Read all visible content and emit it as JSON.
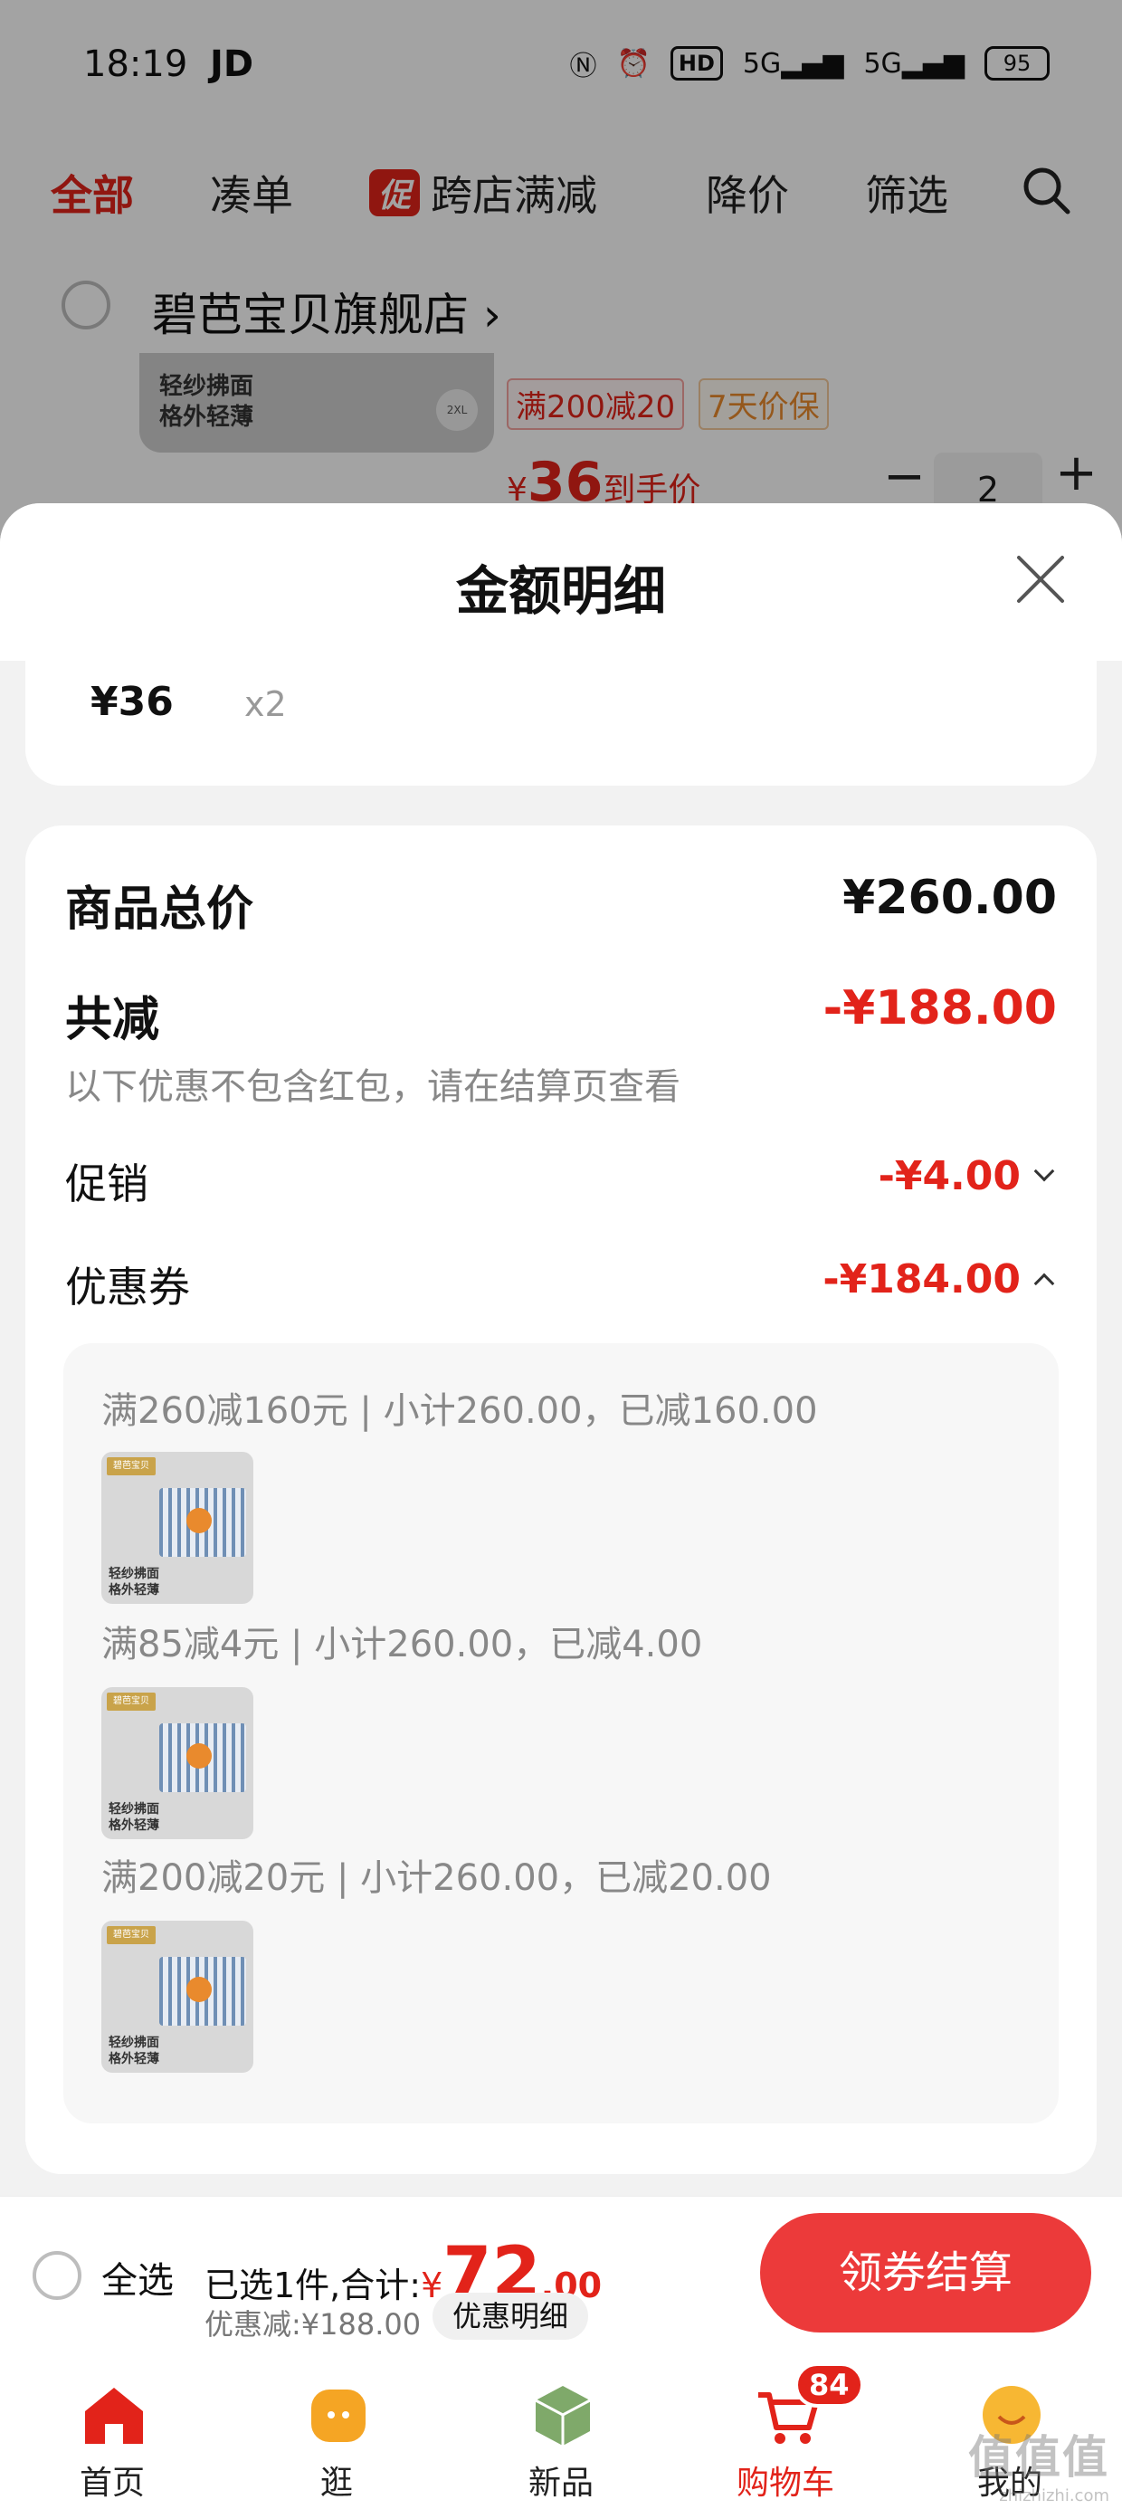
{
  "status_bar": {
    "time": "18:19",
    "carrier": "JD",
    "net_badge": "HD",
    "signal1": "5G",
    "signal2": "5G",
    "battery": "95"
  },
  "tabs": {
    "all": "全部",
    "combine": "凑单",
    "promo_chip": "促",
    "cross_store": "跨店满减",
    "price_drop": "降价",
    "filter": "筛选"
  },
  "shop": {
    "name": "碧芭宝贝旗舰店",
    "thumb_line1": "轻纱拂面",
    "thumb_line2": "格外轻薄",
    "thumb_size": "2XL",
    "tag1": "满200减20",
    "tag2": "7天价保",
    "price_symbol": "¥",
    "price": "36",
    "price_note": "到手价",
    "quantity": "2",
    "minus": "−",
    "plus": "+"
  },
  "sheet": {
    "title": "金额明细",
    "item_price": "¥36",
    "item_qty": "x2",
    "total_label": "商品总价",
    "total_value": "¥260.00",
    "reduce_label": "共减",
    "reduce_value": "-¥188.00",
    "reduce_hint": "以下优惠不包含红包，请在结算页查看",
    "promo_label": "促销",
    "promo_value": "-¥4.00",
    "coupon_label": "优惠券",
    "coupon_value": "-¥184.00",
    "coupons": [
      {
        "text": "满260减160元 | 小计260.00，已减160.00",
        "cap1": "轻纱拂面",
        "cap2": "格外轻薄",
        "brand": "碧芭宝贝"
      },
      {
        "text": "满85减4元 | 小计260.00，已减4.00",
        "cap1": "轻纱拂面",
        "cap2": "格外轻薄",
        "brand": "碧芭宝贝"
      },
      {
        "text": "满200减20元 | 小计260.00，已减20.00",
        "cap1": "轻纱拂面",
        "cap2": "格外轻薄",
        "brand": "碧芭宝贝"
      }
    ]
  },
  "checkout": {
    "select_all": "全选",
    "selected_text": "已选1件,合计:",
    "total_symbol": "¥",
    "total_int": "72",
    "total_dec": ".00",
    "discount_text": "优惠减:¥188.00",
    "detail_chip": "优惠明细",
    "button": "领券结算"
  },
  "nav": {
    "items": [
      {
        "label": "首页",
        "icon": "home-icon"
      },
      {
        "label": "逛",
        "icon": "stroll-icon"
      },
      {
        "label": "新品",
        "icon": "new-products-icon"
      },
      {
        "label": "购物车",
        "icon": "cart-icon",
        "badge": "84"
      },
      {
        "label": "我的",
        "icon": "profile-icon"
      }
    ]
  },
  "watermark": {
    "line1": "值值值",
    "line2": "zhizhizhi.com"
  },
  "colors": {
    "accent_red": "#e2231a",
    "button_red": "#ec3a3a",
    "tag_orange": "#e98a2d"
  }
}
